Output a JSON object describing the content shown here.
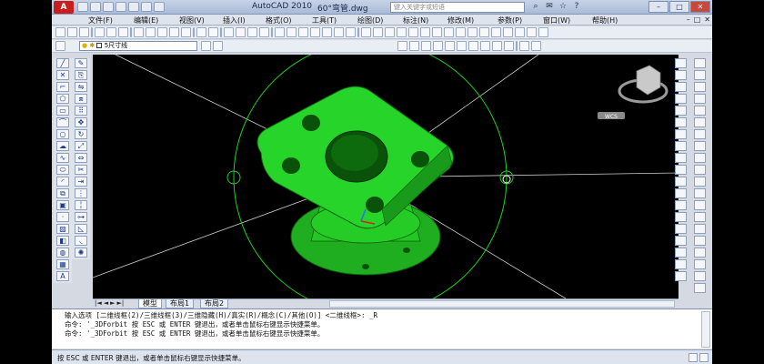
{
  "app": {
    "title": "AutoCAD 2010",
    "file": "60°弯管.dwg",
    "logo": "A"
  },
  "search": {
    "placeholder": "键入关键字或短语"
  },
  "window_buttons": {
    "minimize": "–",
    "maximize": "□",
    "close": "✕"
  },
  "menu": [
    "文件(F)",
    "编辑(E)",
    "视图(V)",
    "插入(I)",
    "格式(O)",
    "工具(T)",
    "绘图(D)",
    "标注(N)",
    "修改(M)",
    "参数(P)",
    "窗口(W)",
    "帮助(H)"
  ],
  "layer": {
    "current": "5尺寸线",
    "bulb_icon": "lightbulb-icon",
    "freeze_icon": "sun-icon"
  },
  "layout_tabs": [
    "模型",
    "布局1",
    "布局2"
  ],
  "active_tab": "模型",
  "command_lines": [
    "输入选项 [二维线框(2)/三维线框(3)/三维隐藏(H)/真实(R)/概念(C)/其他(O)] <二维线框>: _R",
    "命令: '_3DForbit 按 ESC 或 ENTER 键退出，或者单击鼠标右键显示快捷菜单。",
    "命令: '_3DForbit 按 ESC 或 ENTER 键退出，或者单击鼠标右键显示快捷菜单。"
  ],
  "status": {
    "text": "按 ESC 或 ENTER 键退出，或者单击鼠标右键显示快捷菜单。"
  },
  "viewcube": {
    "label": "WCS"
  },
  "colors": {
    "model": "#27d42a",
    "orbit_circle": "#1fd11f",
    "background": "#000000"
  }
}
